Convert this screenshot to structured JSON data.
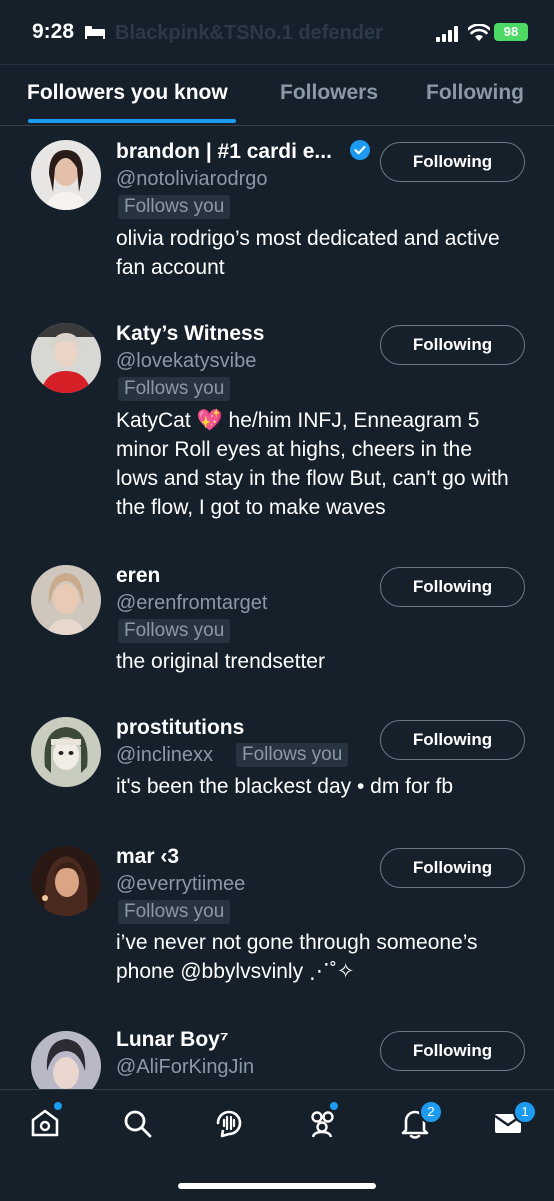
{
  "status_bar": {
    "time": "9:28",
    "faded_title": "Blackpink&TSNo.1 defender",
    "battery": "98"
  },
  "tabs": [
    {
      "label": "Followers you know",
      "active": true
    },
    {
      "label": "Followers",
      "active": false
    },
    {
      "label": "Following",
      "active": false
    }
  ],
  "users": [
    {
      "name": "brandon | #1 cardi e...",
      "handle": "@notoliviarodrgo",
      "follows_you": "Follows you",
      "bio": "olivia rodrigo’s most dedicated and active fan account",
      "button": "Following",
      "verified": true
    },
    {
      "name": "Katy’s Witness",
      "handle": "@lovekatysvibe",
      "follows_you": "Follows you",
      "bio": "KatyCat 💖 he/him INFJ, Enneagram 5 minor Roll eyes at highs, cheers in the lows and stay in the flow But, can't go with the flow, I got to make waves",
      "button": "Following"
    },
    {
      "name": "eren",
      "handle": "@erenfromtarget",
      "follows_you": "Follows you",
      "bio": "the original trendsetter",
      "button": "Following"
    },
    {
      "name": "prostitutions",
      "handle": "@inclinexx",
      "follows_you": "Follows you",
      "bio": "it's been the blackest day • dm for fb",
      "button": "Following"
    },
    {
      "name": "mar ‹3",
      "handle": "@everrytiimee",
      "follows_you": "Follows you",
      "bio": "i’ve never not gone through someone’s phone @bbylvsvinly ⋰˚✧",
      "button": "Following"
    },
    {
      "name": "Lunar Boy⁷",
      "handle": "@AliForKingJin",
      "follows_you": "",
      "bio": "",
      "button": "Following"
    }
  ],
  "bottom_nav": {
    "items": [
      {
        "icon": "home-icon",
        "dot": true
      },
      {
        "icon": "search-icon"
      },
      {
        "icon": "spaces-icon"
      },
      {
        "icon": "communities-icon",
        "dot": true
      },
      {
        "icon": "notifications-icon",
        "badge": "2"
      },
      {
        "icon": "messages-icon",
        "badge": "1"
      }
    ]
  },
  "colors": {
    "background": "#15202b",
    "accent": "#1d9bf0",
    "secondary_text": "#8b98a5"
  }
}
